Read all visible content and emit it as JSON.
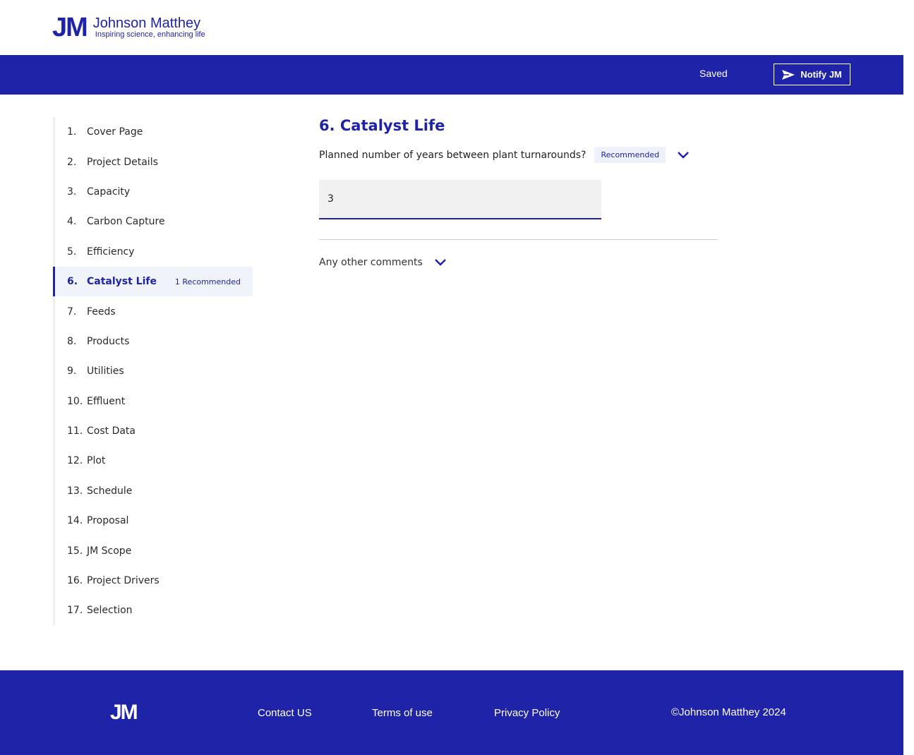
{
  "brand": {
    "mark": "JM",
    "name": "Johnson Matthey",
    "tagline": "Inspiring science, enhancing life",
    "color": "#1f23a8"
  },
  "navbar": {
    "status": "Saved",
    "notify_label": "Notify JM",
    "notify_icon": "send-icon"
  },
  "sidebar": {
    "items": [
      {
        "num": "1.",
        "label": "Cover Page"
      },
      {
        "num": "2.",
        "label": "Project Details"
      },
      {
        "num": "3.",
        "label": "Capacity"
      },
      {
        "num": "4.",
        "label": "Carbon Capture"
      },
      {
        "num": "5.",
        "label": "Efficiency"
      },
      {
        "num": "6.",
        "label": "Catalyst Life",
        "badge": "1 Recommended",
        "active": true
      },
      {
        "num": "7.",
        "label": "Feeds"
      },
      {
        "num": "8.",
        "label": "Products"
      },
      {
        "num": "9.",
        "label": "Utilities"
      },
      {
        "num": "10.",
        "label": "Effluent"
      },
      {
        "num": "11.",
        "label": "Cost Data"
      },
      {
        "num": "12.",
        "label": "Plot"
      },
      {
        "num": "13.",
        "label": "Schedule"
      },
      {
        "num": "14.",
        "label": "Proposal"
      },
      {
        "num": "15.",
        "label": "JM Scope"
      },
      {
        "num": "16.",
        "label": "Project Drivers"
      },
      {
        "num": "17.",
        "label": "Selection"
      }
    ]
  },
  "main": {
    "title": "6. Catalyst Life",
    "question": "Planned number of years between plant turnarounds?",
    "question_badge": "Recommended",
    "answer_value": "3",
    "comments_label": "Any other comments"
  },
  "footer": {
    "mark": "JM",
    "links": [
      "Contact US",
      "Terms of use",
      "Privacy Policy"
    ],
    "copyright": "©Johnson Matthey 2024"
  }
}
